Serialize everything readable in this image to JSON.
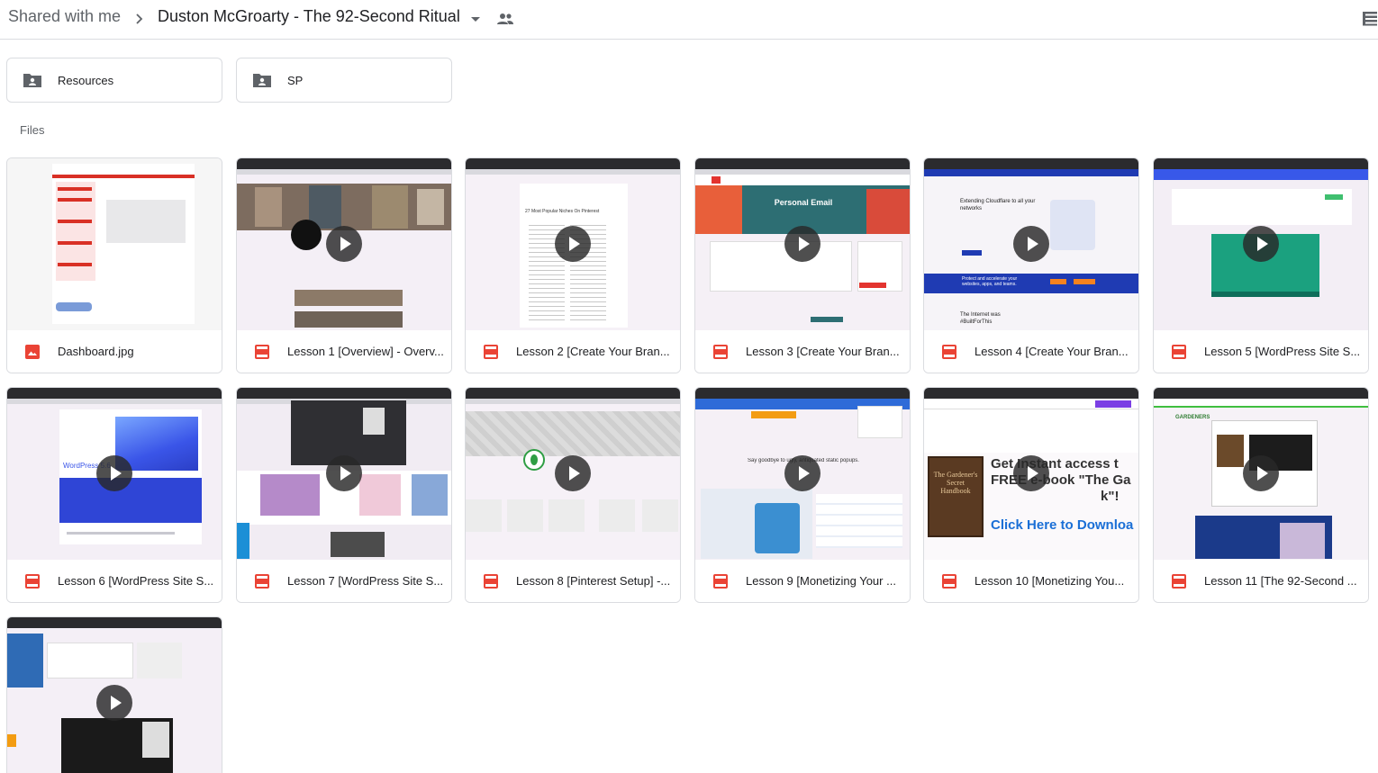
{
  "breadcrumb": {
    "root": "Shared with me",
    "current": "Duston McGroarty - The 92-Second Ritual"
  },
  "folders": [
    {
      "name": "Resources"
    },
    {
      "name": "SP"
    }
  ],
  "sections": {
    "files": "Files"
  },
  "files": [
    {
      "name": "Dashboard.jpg",
      "type": "image"
    },
    {
      "name": "Lesson 1 [Overview] - Overv...",
      "type": "video"
    },
    {
      "name": "Lesson 2 [Create Your Bran...",
      "type": "video"
    },
    {
      "name": "Lesson 3 [Create Your Bran...",
      "type": "video"
    },
    {
      "name": "Lesson 4 [Create Your Bran...",
      "type": "video"
    },
    {
      "name": "Lesson 5 [WordPress Site S...",
      "type": "video"
    },
    {
      "name": "Lesson 6 [WordPress Site S...",
      "type": "video"
    },
    {
      "name": "Lesson 7 [WordPress Site S...",
      "type": "video"
    },
    {
      "name": "Lesson 8 [Pinterest Setup] -...",
      "type": "video"
    },
    {
      "name": "Lesson 9 [Monetizing Your ...",
      "type": "video"
    },
    {
      "name": "Lesson 10 [Monetizing You...",
      "type": "video"
    },
    {
      "name": "Lesson 11 [The 92-Second ...",
      "type": "video"
    },
    {
      "name": "",
      "type": "video"
    }
  ],
  "thumb_text": {
    "t2_title": "27 Most Popular Niches On Pinterest",
    "t3_title": "Personal Email",
    "t4_title": "Extending Cloudflare to all your networks",
    "t4_sub": "Protect and accelerate your websites, apps, and teams.",
    "t4_foot": "The Internet was #BuiltForThis",
    "t6_title": "WordPress 5.6",
    "t9_title": "Say goodbye to ugly, antiquated static popups.",
    "t10_line1": "Get Instant access t",
    "t10_line2": "FREE e-book \"The Ga",
    "t10_line3": "k\"!",
    "t10_cta": "Click Here to Downloa",
    "t10_book": "The Gardener's Secret Handbook",
    "t11_brand": "GARDENERS"
  },
  "colors": {
    "accent_red": "#d93025",
    "pdf_red": "#ea4335",
    "icon_grey": "#5f6368",
    "border": "#dadce0"
  }
}
